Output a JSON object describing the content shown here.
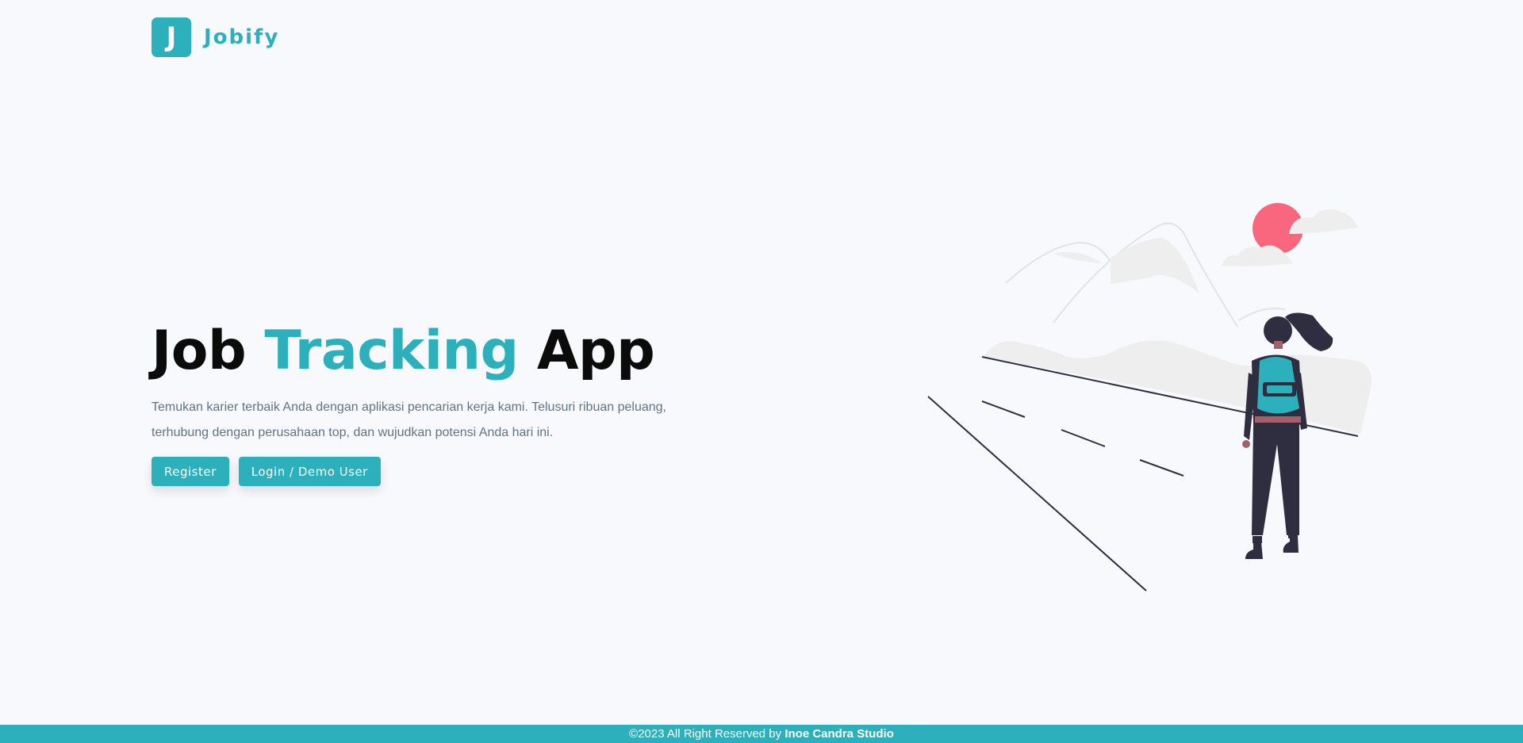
{
  "brand": {
    "logo_letter": "J",
    "name": "Jobify"
  },
  "hero": {
    "title_part1": "Job ",
    "title_accent": "Tracking",
    "title_part2": " App",
    "description": "Temukan karier terbaik Anda dengan aplikasi pencarian kerja kami. Telusuri ribuan peluang, terhubung dengan perusahaan top, dan wujudkan potensi Anda hari ini.",
    "register_label": "Register",
    "login_label": "Login / Demo User"
  },
  "illustration": {
    "icon": "woman-with-backpack-hiking-illustration"
  },
  "footer": {
    "copyright": "©2023 All Right Reserved by ",
    "studio": "Inoe Candra Studio"
  },
  "colors": {
    "primary": "#2cb1bc",
    "background": "#f8f9fd",
    "text_muted": "#627386",
    "sun": "#f9677f",
    "figure_dark": "#2f2e41"
  }
}
